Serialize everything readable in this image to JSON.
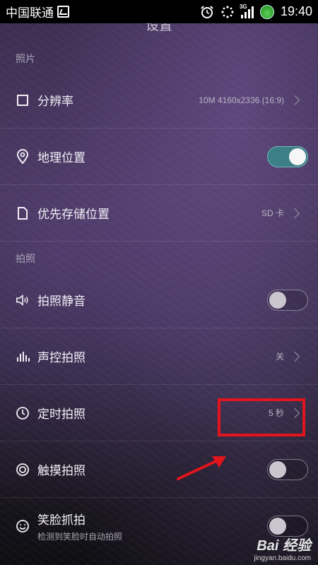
{
  "status_bar": {
    "carrier": "中国联通",
    "network_tag": "3G",
    "time": "19:40"
  },
  "title": "设置",
  "sections": {
    "photo": "照片",
    "shooting": "拍照"
  },
  "rows": {
    "resolution": {
      "label": "分辨率",
      "value": "10M 4160x2336 (16:9)",
      "icon": "square-icon"
    },
    "location": {
      "label": "地理位置",
      "toggle_on": true,
      "icon": "location-pin-icon"
    },
    "storage": {
      "label": "优先存储位置",
      "value": "SD 卡",
      "icon": "file-icon"
    },
    "mute": {
      "label": "拍照静音",
      "toggle_on": false,
      "icon": "speaker-icon"
    },
    "voice": {
      "label": "声控拍照",
      "value": "关",
      "icon": "sound-bars-icon"
    },
    "timer": {
      "label": "定时拍照",
      "value": "5 秒",
      "icon": "clock-icon"
    },
    "touch": {
      "label": "触摸拍照",
      "toggle_on": false,
      "icon": "target-icon"
    },
    "smile": {
      "label": "笑脸抓拍",
      "sub": "检测到笑脸时自动拍照",
      "toggle_on": false,
      "icon": "smile-icon"
    }
  },
  "annotation": {
    "color": "#e2141c"
  },
  "watermark": {
    "brand": "Bai 经验",
    "site": "jingyan.baidu.com"
  }
}
